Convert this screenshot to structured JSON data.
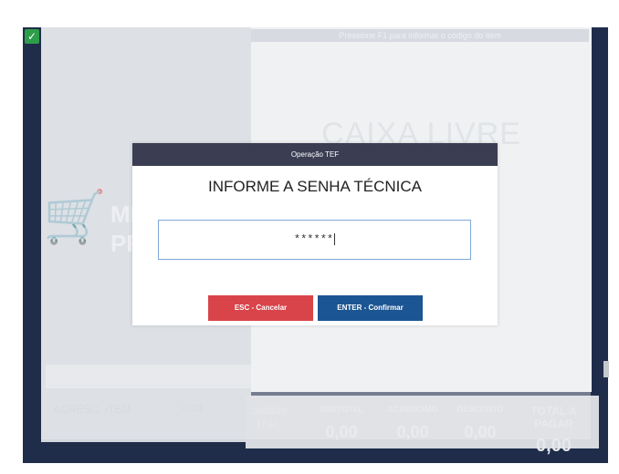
{
  "app": {
    "hint": "Pressione F1 para informar o código do item",
    "status_text": "CAIXA LIVRE",
    "logo_line1": "ME",
    "logo_line2": "PRE",
    "check_glyph": "✓",
    "subtotal_left_label": "ACRÉSC. ITEM",
    "subtotal_left_value": "0,00",
    "date": "30/03/26",
    "time": "17:44",
    "totals": [
      {
        "label": "SUBTOTAL",
        "value": "0,00"
      },
      {
        "label": "ACRÉSCIMO",
        "value": "0,00"
      },
      {
        "label": "DESCONTO",
        "value": "0,00"
      },
      {
        "label": "TOTAL A PAGAR",
        "value": "0,00"
      }
    ]
  },
  "dialog": {
    "header": "Operação TEF",
    "title": "INFORME A SENHA TÉCNICA",
    "password_value": "******",
    "cancel_label": "ESC - Cancelar",
    "confirm_label": "ENTER - Confirmar"
  },
  "colors": {
    "header_bg": "#3b3d52",
    "cancel_bg": "#d9444a",
    "confirm_bg": "#1c5593",
    "input_border": "#7fa8d8"
  }
}
